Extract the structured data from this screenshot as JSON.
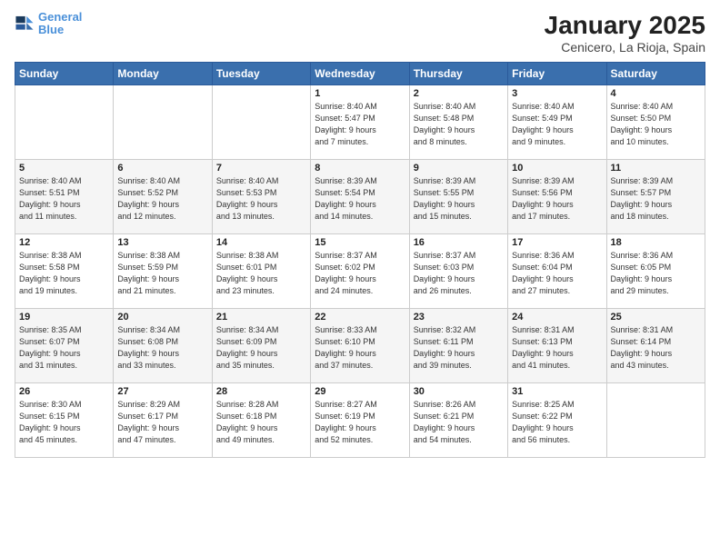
{
  "logo": {
    "line1": "General",
    "line2": "Blue"
  },
  "title": "January 2025",
  "subtitle": "Cenicero, La Rioja, Spain",
  "days_header": [
    "Sunday",
    "Monday",
    "Tuesday",
    "Wednesday",
    "Thursday",
    "Friday",
    "Saturday"
  ],
  "weeks": [
    [
      {
        "num": "",
        "info": ""
      },
      {
        "num": "",
        "info": ""
      },
      {
        "num": "",
        "info": ""
      },
      {
        "num": "1",
        "info": "Sunrise: 8:40 AM\nSunset: 5:47 PM\nDaylight: 9 hours\nand 7 minutes."
      },
      {
        "num": "2",
        "info": "Sunrise: 8:40 AM\nSunset: 5:48 PM\nDaylight: 9 hours\nand 8 minutes."
      },
      {
        "num": "3",
        "info": "Sunrise: 8:40 AM\nSunset: 5:49 PM\nDaylight: 9 hours\nand 9 minutes."
      },
      {
        "num": "4",
        "info": "Sunrise: 8:40 AM\nSunset: 5:50 PM\nDaylight: 9 hours\nand 10 minutes."
      }
    ],
    [
      {
        "num": "5",
        "info": "Sunrise: 8:40 AM\nSunset: 5:51 PM\nDaylight: 9 hours\nand 11 minutes."
      },
      {
        "num": "6",
        "info": "Sunrise: 8:40 AM\nSunset: 5:52 PM\nDaylight: 9 hours\nand 12 minutes."
      },
      {
        "num": "7",
        "info": "Sunrise: 8:40 AM\nSunset: 5:53 PM\nDaylight: 9 hours\nand 13 minutes."
      },
      {
        "num": "8",
        "info": "Sunrise: 8:39 AM\nSunset: 5:54 PM\nDaylight: 9 hours\nand 14 minutes."
      },
      {
        "num": "9",
        "info": "Sunrise: 8:39 AM\nSunset: 5:55 PM\nDaylight: 9 hours\nand 15 minutes."
      },
      {
        "num": "10",
        "info": "Sunrise: 8:39 AM\nSunset: 5:56 PM\nDaylight: 9 hours\nand 17 minutes."
      },
      {
        "num": "11",
        "info": "Sunrise: 8:39 AM\nSunset: 5:57 PM\nDaylight: 9 hours\nand 18 minutes."
      }
    ],
    [
      {
        "num": "12",
        "info": "Sunrise: 8:38 AM\nSunset: 5:58 PM\nDaylight: 9 hours\nand 19 minutes."
      },
      {
        "num": "13",
        "info": "Sunrise: 8:38 AM\nSunset: 5:59 PM\nDaylight: 9 hours\nand 21 minutes."
      },
      {
        "num": "14",
        "info": "Sunrise: 8:38 AM\nSunset: 6:01 PM\nDaylight: 9 hours\nand 23 minutes."
      },
      {
        "num": "15",
        "info": "Sunrise: 8:37 AM\nSunset: 6:02 PM\nDaylight: 9 hours\nand 24 minutes."
      },
      {
        "num": "16",
        "info": "Sunrise: 8:37 AM\nSunset: 6:03 PM\nDaylight: 9 hours\nand 26 minutes."
      },
      {
        "num": "17",
        "info": "Sunrise: 8:36 AM\nSunset: 6:04 PM\nDaylight: 9 hours\nand 27 minutes."
      },
      {
        "num": "18",
        "info": "Sunrise: 8:36 AM\nSunset: 6:05 PM\nDaylight: 9 hours\nand 29 minutes."
      }
    ],
    [
      {
        "num": "19",
        "info": "Sunrise: 8:35 AM\nSunset: 6:07 PM\nDaylight: 9 hours\nand 31 minutes."
      },
      {
        "num": "20",
        "info": "Sunrise: 8:34 AM\nSunset: 6:08 PM\nDaylight: 9 hours\nand 33 minutes."
      },
      {
        "num": "21",
        "info": "Sunrise: 8:34 AM\nSunset: 6:09 PM\nDaylight: 9 hours\nand 35 minutes."
      },
      {
        "num": "22",
        "info": "Sunrise: 8:33 AM\nSunset: 6:10 PM\nDaylight: 9 hours\nand 37 minutes."
      },
      {
        "num": "23",
        "info": "Sunrise: 8:32 AM\nSunset: 6:11 PM\nDaylight: 9 hours\nand 39 minutes."
      },
      {
        "num": "24",
        "info": "Sunrise: 8:31 AM\nSunset: 6:13 PM\nDaylight: 9 hours\nand 41 minutes."
      },
      {
        "num": "25",
        "info": "Sunrise: 8:31 AM\nSunset: 6:14 PM\nDaylight: 9 hours\nand 43 minutes."
      }
    ],
    [
      {
        "num": "26",
        "info": "Sunrise: 8:30 AM\nSunset: 6:15 PM\nDaylight: 9 hours\nand 45 minutes."
      },
      {
        "num": "27",
        "info": "Sunrise: 8:29 AM\nSunset: 6:17 PM\nDaylight: 9 hours\nand 47 minutes."
      },
      {
        "num": "28",
        "info": "Sunrise: 8:28 AM\nSunset: 6:18 PM\nDaylight: 9 hours\nand 49 minutes."
      },
      {
        "num": "29",
        "info": "Sunrise: 8:27 AM\nSunset: 6:19 PM\nDaylight: 9 hours\nand 52 minutes."
      },
      {
        "num": "30",
        "info": "Sunrise: 8:26 AM\nSunset: 6:21 PM\nDaylight: 9 hours\nand 54 minutes."
      },
      {
        "num": "31",
        "info": "Sunrise: 8:25 AM\nSunset: 6:22 PM\nDaylight: 9 hours\nand 56 minutes."
      },
      {
        "num": "",
        "info": ""
      }
    ]
  ]
}
